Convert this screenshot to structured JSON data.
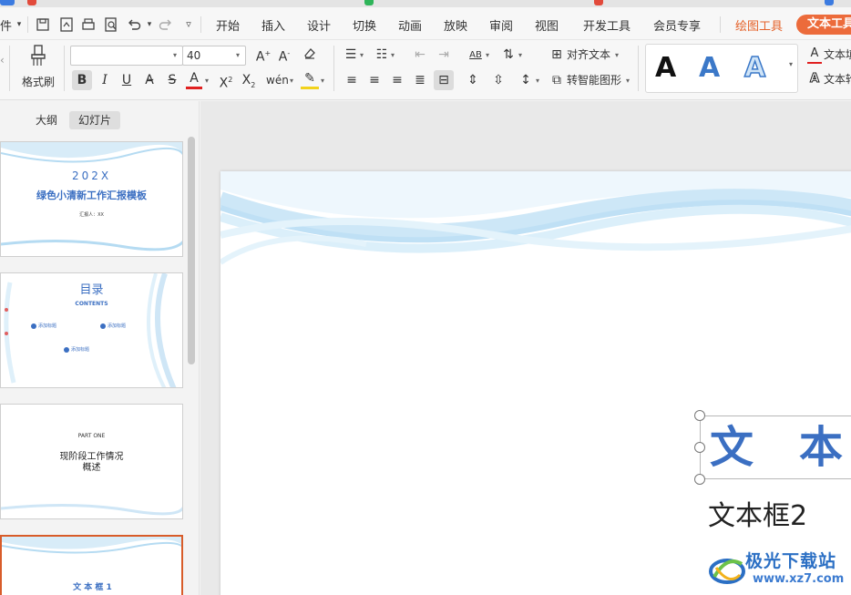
{
  "menu": {
    "left_fragment": "件",
    "tabs": [
      "开始",
      "插入",
      "设计",
      "切换",
      "动画",
      "放映",
      "审阅",
      "视图",
      "开发工具",
      "会员专享"
    ],
    "drawing_tools": "绘图工具",
    "text_tools": "文本工具"
  },
  "ribbon": {
    "format_painter": "格式刷",
    "font_name": "",
    "font_size": "40",
    "align_text": "对齐文本",
    "smartart": "转智能图形",
    "text_fill": "文本填",
    "text_outline": "文本轮"
  },
  "panel": {
    "tab_outline": "大纲",
    "tab_slides": "幻灯片"
  },
  "thumbnails": [
    {
      "year": "202X",
      "title": "绿色小清新工作汇报模板",
      "reporter": "汇报人：XX"
    },
    {
      "title": "目录",
      "subtitle": "CONTENTS",
      "item1": "添加标题",
      "item2": "添加标题",
      "item3": "添加标题"
    },
    {
      "part": "PART ONE",
      "line1": "现阶段工作情况",
      "line2": "概述"
    },
    {
      "title": "文 本 框 1"
    }
  ],
  "slide": {
    "textbox1": "文本",
    "textbox2": "文本框2"
  },
  "watermark": {
    "name": "极光下载站",
    "url": "www.xz7.com"
  },
  "colors": {
    "accent_orange": "#ec6b3b",
    "title_blue": "#3b6fc2"
  }
}
